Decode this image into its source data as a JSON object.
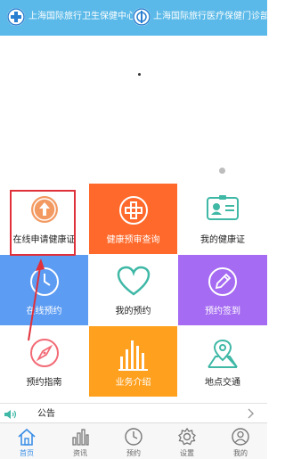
{
  "header": {
    "org1": "上海国际旅行卫生保健中心",
    "org2": "上海国际旅行医疗保健门诊部"
  },
  "grid": {
    "online_apply": "在线申请健康证",
    "health_check_query": "健康预审查询",
    "my_health_cert": "我的健康证",
    "online_booking": "在线预约",
    "my_booking": "我的预约",
    "booking_checkin": "预约签到",
    "booking_guide": "预约指南",
    "business_intro": "业务介绍",
    "location_traffic": "地点交通"
  },
  "notice": {
    "label": "公告"
  },
  "tabbar": {
    "home": "首页",
    "news": "资讯",
    "booking": "预约",
    "settings": "设置",
    "mine": "我的"
  },
  "colors": {
    "header_bg": "#5ab9e8",
    "orange": "#ff6a2c",
    "blue": "#5d9cf3",
    "purple": "#a56bf2",
    "amber": "#ffa01e",
    "teal_icon": "#3fb8a6",
    "highlight_red": "#e0303a",
    "active_tab": "#3a8ee6"
  }
}
